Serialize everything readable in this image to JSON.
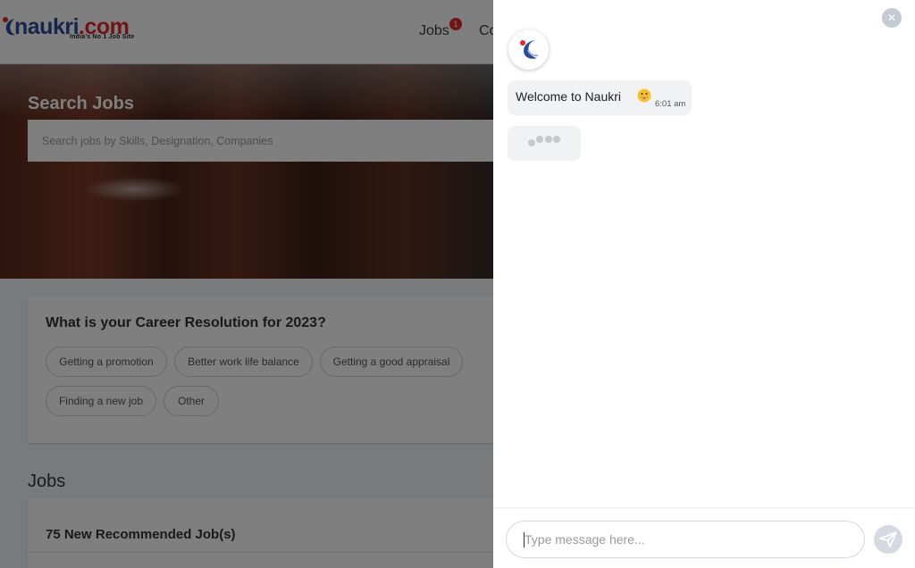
{
  "header": {
    "logo_text": "naukri",
    "logo_suffix": ".com",
    "logo_tagline": "India's No 1 Job Site",
    "nav": {
      "jobs_label": "Jobs",
      "jobs_badge": "1",
      "companies_label_partial": "Co"
    }
  },
  "hero": {
    "title": "Search Jobs",
    "search_placeholder": "Search jobs by Skills, Designation, Companies"
  },
  "resolution": {
    "title": "What is your Career Resolution for 2023?",
    "options": [
      "Getting a promotion",
      "Better work life balance",
      "Getting a good appraisal",
      "Finding a new job",
      "Other"
    ]
  },
  "jobs": {
    "heading": "Jobs",
    "recommended_label": "75 New Recommended Job(s)"
  },
  "chat": {
    "messages": [
      {
        "from": "bot",
        "text": "Welcome to Naukri",
        "emoji": "grinning-face",
        "time": "6:01 am"
      }
    ],
    "typing_indicator": true,
    "input_placeholder": "Type message here..."
  },
  "colors": {
    "brand_blue": "#2a4b9b",
    "brand_red": "#e0282e",
    "overlay": "rgba(0,0,0,0.5)",
    "bubble_bg": "#f1f2f4"
  }
}
